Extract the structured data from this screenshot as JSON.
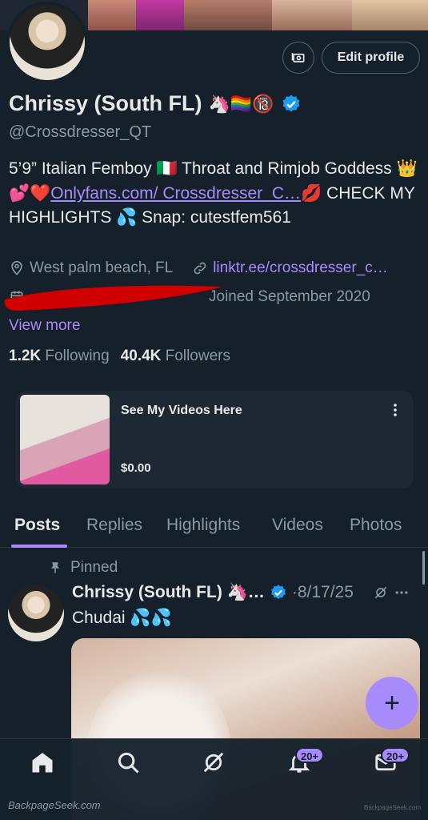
{
  "profile": {
    "display_name": "Chrissy (South FL)",
    "name_emojis": "🦄🏳️‍🌈🔞",
    "handle": "@Crossdresser_QT",
    "verified": true,
    "edit_profile_label": "Edit profile",
    "bio_part1": "5’9” Italian Femboy 🇮🇹 Throat and Rimjob Goddess 👑 💕❤️",
    "bio_link": "Onlyfans.com/ Crossdresser_C…",
    "bio_part2": "💋 CHECK MY HIGHLIGHTS 💦 Snap: cutestfem561",
    "location": "West palm beach, FL",
    "website": "linktr.ee/crossdresser_c…",
    "joined": "Joined September 2020",
    "view_more": "View more",
    "following_count": "1.2K",
    "following_label": "Following",
    "followers_count": "40.4K",
    "followers_label": "Followers"
  },
  "product_card": {
    "title": "See My Videos Here",
    "price": "$0.00"
  },
  "tabs": [
    {
      "label": "Posts",
      "active": true
    },
    {
      "label": "Replies",
      "active": false
    },
    {
      "label": "Highlights",
      "active": false
    },
    {
      "label": "Videos",
      "active": false
    },
    {
      "label": "Photos",
      "active": false
    }
  ],
  "post": {
    "pinned_label": "Pinned",
    "author": "Chrissy (South FL) 🦄…",
    "date": "·8/17/25",
    "text": "Chudai 💦💦"
  },
  "fab": {
    "icon": "plus-icon",
    "label": "+"
  },
  "bottom_nav": {
    "items": [
      "home-icon",
      "search-icon",
      "grok-icon",
      "notifications-icon",
      "messages-icon"
    ],
    "notifications_badge": "20+",
    "messages_badge": "20+"
  },
  "watermark": {
    "left": "BackpageSeek.com",
    "right": "BackpageSeek.com"
  },
  "colors": {
    "background": "#15202b",
    "accent": "#a78bfa",
    "secondary_text": "#8b98a5",
    "verified_blue": "#1d9bf0"
  }
}
